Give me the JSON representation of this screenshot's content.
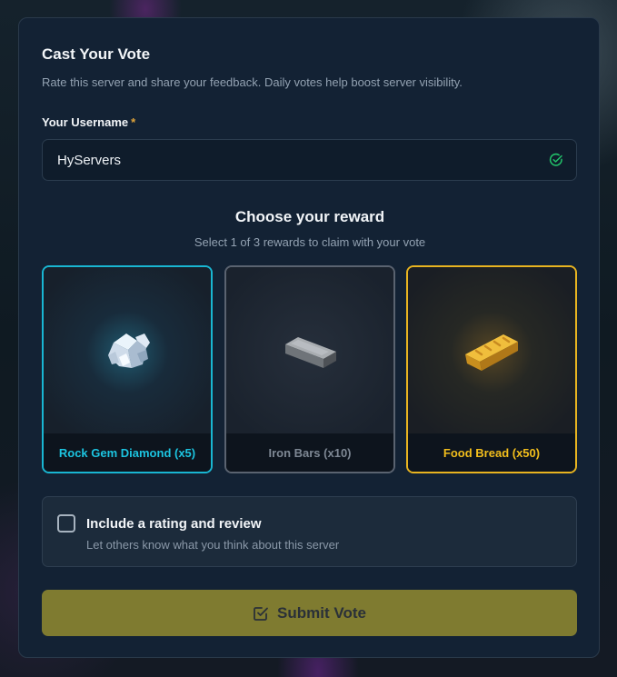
{
  "form": {
    "title": "Cast Your Vote",
    "subtitle": "Rate this server and share your feedback. Daily votes help boost server visibility.",
    "username_label": "Your Username",
    "required_mark": "*",
    "username_value": "HyServers",
    "username_status_icon": "check-circle-icon"
  },
  "reward": {
    "title": "Choose your reward",
    "subtitle": "Select 1 of 3 rewards to claim with your vote",
    "options": [
      {
        "label": "Rock Gem Diamond (x5)",
        "icon": "diamond-gem-icon",
        "color": "#1cc4e0",
        "state": "selected"
      },
      {
        "label": "Iron Bars (x10)",
        "icon": "iron-bar-icon",
        "color": "#7e8894",
        "state": "normal"
      },
      {
        "label": "Food Bread (x50)",
        "icon": "bread-icon",
        "color": "#f2be1c",
        "state": "highlighted"
      }
    ]
  },
  "review": {
    "checked": false,
    "label": "Include a rating and review",
    "hint": "Let others know what you think about this server"
  },
  "submit": {
    "label": "Submit Vote",
    "icon": "check-square-icon",
    "color": "#7f7b30"
  }
}
